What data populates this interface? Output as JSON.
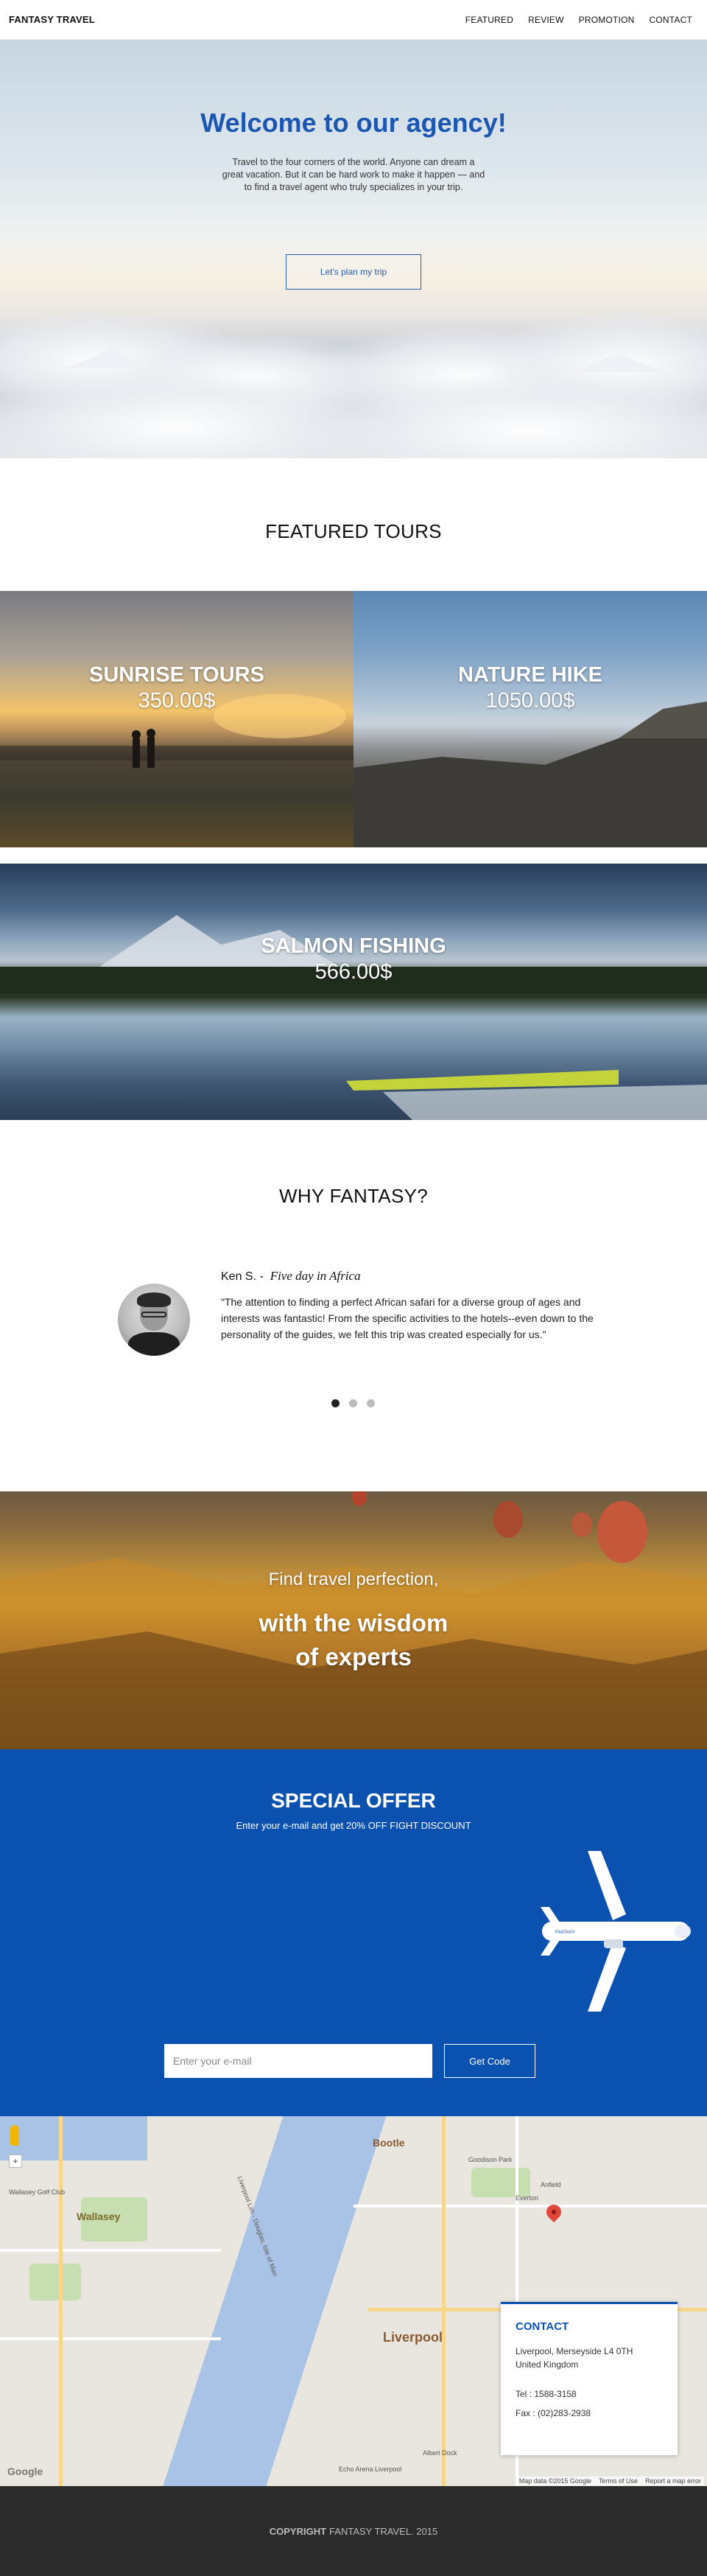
{
  "nav": {
    "brand": "FANTASY TRAVEL",
    "items": [
      "FEATURED",
      "REVIEW",
      "PROMOTION",
      "CONTACT"
    ]
  },
  "hero": {
    "title": "Welcome to our agency!",
    "text": "Travel to the four corners of the world. Anyone can dream a great vacation. But it can be hard work to make it happen — and to find a travel agent who truly specializes in your trip.",
    "button": "Let's plan my trip"
  },
  "featured": {
    "title": "FEATURED TOURS",
    "tours": [
      {
        "name": "SUNRISE TOURS",
        "price": "350.00$"
      },
      {
        "name": "NATURE HIKE",
        "price": "1050.00$"
      },
      {
        "name": "SALMON FISHING",
        "price": "566.00$"
      }
    ]
  },
  "why": {
    "title": "WHY FANTASY?",
    "reviewer": "Ken S.",
    "separator": "-",
    "tour": "Five day in Africa",
    "quote": "\"The attention to finding a perfect African safari for a diverse group of ages and interests was fantastic! From the specific activities to the hotels--even down to the personality of the guides, we felt this trip was created especially for us.\""
  },
  "band": {
    "line1": "Find travel perfection,",
    "line2a": "with the wisdom",
    "line2b": "of experts"
  },
  "offer": {
    "title": "SPECIAL OFFER",
    "subtitle": "Enter your e-mail and get 20% OFF FIGHT DISCOUNT",
    "email_placeholder": "Enter your e-mail",
    "button": "Get Code",
    "plane_text": "FANTASY"
  },
  "map": {
    "labels": {
      "bootle": "Bootle",
      "wallasey": "Wallasey",
      "liverpool": "Liverpool",
      "anfield": "Anfield",
      "everton": "Everton",
      "goodison": "Goodison Park",
      "river": "Liverpool Lim - Douglas, Isle of Man",
      "golf": "Wallasey Golf Club",
      "albert": "Albert Dock",
      "echo": "Echo Arena Liverpool"
    },
    "footer": [
      "Map data ©2015 Google",
      "Terms of Use",
      "Report a map error"
    ],
    "google": "Google"
  },
  "contact": {
    "title": "CONTACT",
    "address": "Liverpool, Merseyside L4 0TH United Kingdom",
    "tel": "Tel : 1588-3158",
    "fax": "Fax : (02)283-2938"
  },
  "footer": {
    "copyright": "COPYRIGHT",
    "text": "FANTASY TRAVEL. 2015"
  },
  "colors": {
    "accent": "#0b52b0",
    "hero_title": "#1b56b0",
    "footer_bg": "#2b2b2b"
  }
}
